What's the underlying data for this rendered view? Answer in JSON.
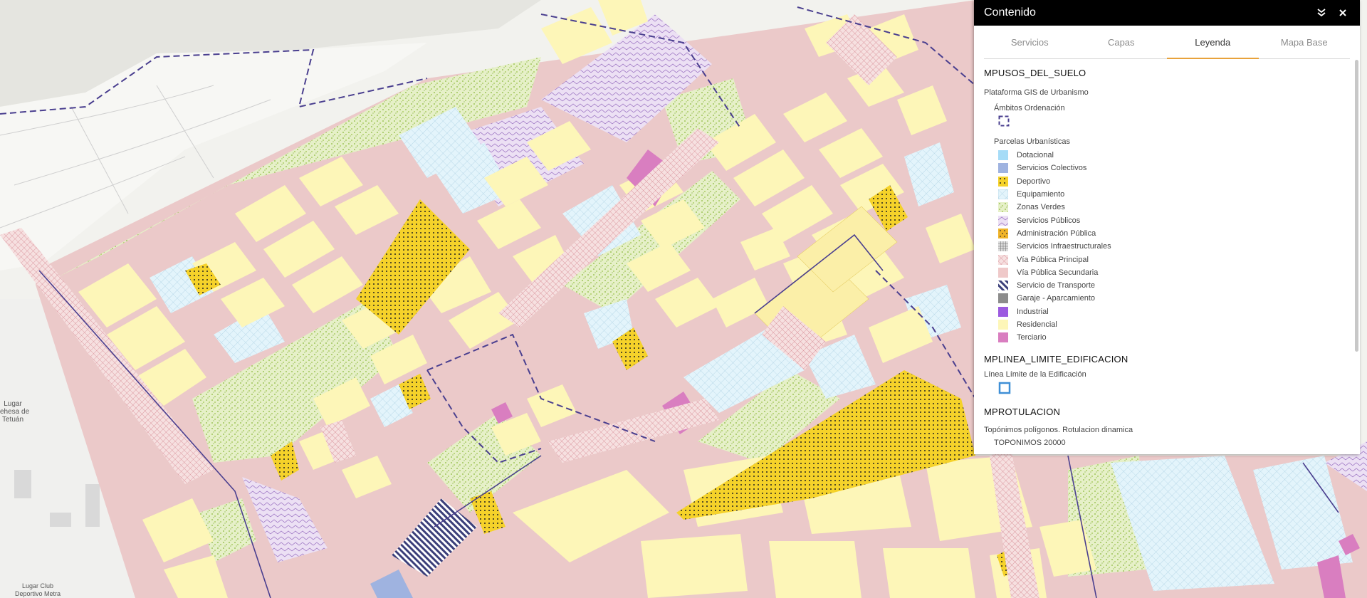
{
  "map": {
    "labels": {
      "dehesa": "Lugar\nehesa de\nTetuán",
      "club": "Lugar Club\nDeportivo Metra"
    }
  },
  "panel": {
    "title": "Contenido",
    "collapse_icon": "double-chevron-down-icon",
    "close_icon": "close-icon",
    "tabs": [
      {
        "label": "Servicios",
        "active": false
      },
      {
        "label": "Capas",
        "active": false
      },
      {
        "label": "Leyenda",
        "active": true
      },
      {
        "label": "Mapa Base",
        "active": false
      }
    ]
  },
  "legend": {
    "layer1": {
      "title": "MPUSOS_DEL_SUELO",
      "service": "Plataforma GIS de Urbanismo",
      "group1": "Ámbitos Ordenación",
      "group2": "Parcelas Urbanísticas",
      "items": [
        {
          "label": "Dotacional",
          "color": "#a6dcf7"
        },
        {
          "label": "Servicios Colectivos",
          "color": "#9fb3e0"
        },
        {
          "label": "Deportivo",
          "color": "#f5d22a"
        },
        {
          "label": "Equipamiento",
          "color": "#e3f4fb"
        },
        {
          "label": "Zonas Verdes",
          "color": "#cde29a"
        },
        {
          "label": "Servicios Públicos",
          "color": "#d8c4ea"
        },
        {
          "label": "Administración Pública",
          "color": "#f0b42a"
        },
        {
          "label": "Servicios Infraestructurales",
          "color": "#bcbcbc"
        },
        {
          "label": "Vía Pública Principal",
          "color": "#f4dcdc"
        },
        {
          "label": "Vía Pública Secundaria",
          "color": "#efc9c9"
        },
        {
          "label": "Servicio de Transporte",
          "color": "#3b3f7a"
        },
        {
          "label": "Garaje - Aparcamiento",
          "color": "#8c8c8c"
        },
        {
          "label": "Industrial",
          "color": "#9c5ae0"
        },
        {
          "label": "Residencial",
          "color": "#fdf6b8"
        },
        {
          "label": "Terciario",
          "color": "#d97ec0"
        }
      ]
    },
    "layer2": {
      "title": "MPLINEA_LIMITE_EDIFICACION",
      "service": "Línea Límite de la Edificación"
    },
    "layer3": {
      "title": "MPROTULACION",
      "service": "Topónimos polígonos. Rotulacion dinamica",
      "group1": "TOPONIMOS 20000"
    }
  }
}
